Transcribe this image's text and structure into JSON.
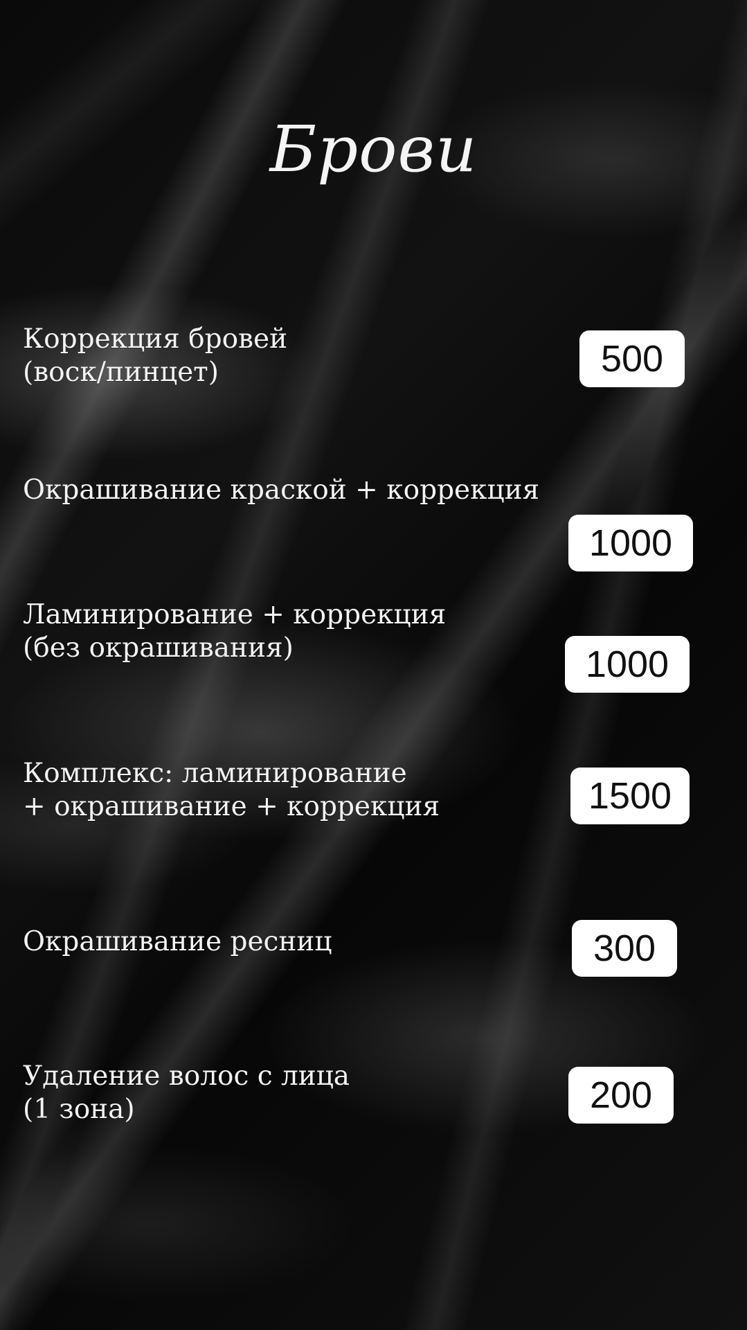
{
  "title": "Брови",
  "services": [
    {
      "lines": [
        "Коррекция бровей",
        "(воск/пинцет)"
      ],
      "price": "500"
    },
    {
      "lines": [
        "Окрашивание краской + коррекция"
      ],
      "price": "1000"
    },
    {
      "lines": [
        "Ламинирование + коррекция",
        "(без окрашивания)"
      ],
      "price": "1000"
    },
    {
      "lines": [
        "Комплекс: ламинирование",
        "+ окрашивание + коррекция"
      ],
      "price": "1500"
    },
    {
      "lines": [
        "Окрашивание ресниц"
      ],
      "price": "300"
    },
    {
      "lines": [
        "Удаление волос с лица",
        "(1 зона)"
      ],
      "price": "200"
    }
  ]
}
